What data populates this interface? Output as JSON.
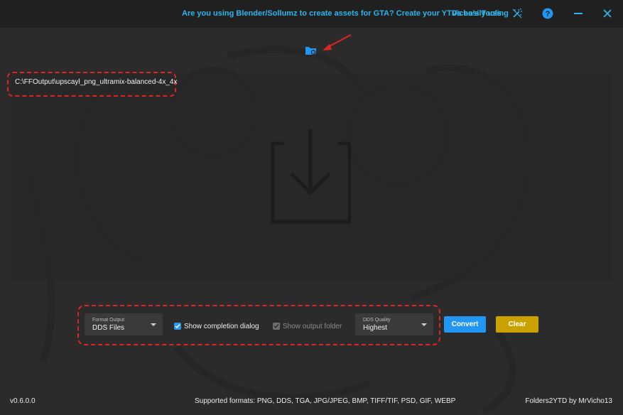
{
  "titlebar": {
    "promo": "Are you using Blender/Sollumz to create assets for GTA? Create your YTDs easily using",
    "tools_link": "Vicho's Tools"
  },
  "main": {
    "path": "C:\\FFOutput\\upscayl_png_ultramix-balanced-4x_4x"
  },
  "controls": {
    "format_output": {
      "label": "Format Output",
      "value": "DDS Files"
    },
    "show_completion_dialog": {
      "label": "Show completion dialog",
      "checked": true
    },
    "show_output_folder": {
      "label": "Show output folder",
      "checked": true,
      "disabled": true
    },
    "dds_quality": {
      "label": "DDS Quality",
      "value": "Highest"
    },
    "convert_label": "Convert",
    "clear_label": "Clear"
  },
  "footer": {
    "version": "v0.6.0.0",
    "formats": "Supported formats: PNG, DDS, TGA, JPG/JPEG, BMP, TIFF/TIF, PSD, GIF, WEBP",
    "credit": "Folders2YTD by MrVicho13"
  },
  "colors": {
    "accent": "#2196f3",
    "link": "#2fb4ea",
    "clear": "#c9a200",
    "annotation": "#e02424"
  }
}
